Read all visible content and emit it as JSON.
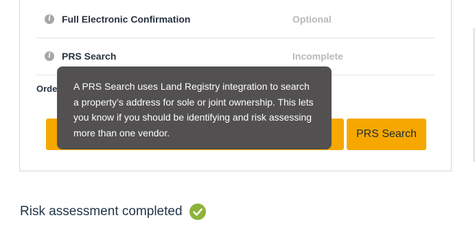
{
  "checklist": {
    "rows": [
      {
        "label": "Full Electronic Confirmation",
        "status": "Optional",
        "icon": "info-icon"
      },
      {
        "label": "PRS Search",
        "status": "Incomplete",
        "icon": "info-icon"
      }
    ],
    "order_label": "Orde"
  },
  "tooltip": {
    "text": "A PRS Search uses Land Registry integration to search a property’s address for sole or joint ownership. This lets you know if you should be identifying and risk assessing more than one vendor."
  },
  "buttons": {
    "prs_search_label": "PRS Search"
  },
  "risk_assessment": {
    "title": "Risk assessment completed",
    "icon": "check-circle-icon",
    "icon_color": "#8db33a"
  },
  "colors": {
    "accent": "#f6a800",
    "tooltip_bg": "#525050",
    "muted_status": "#b9b9b9"
  }
}
